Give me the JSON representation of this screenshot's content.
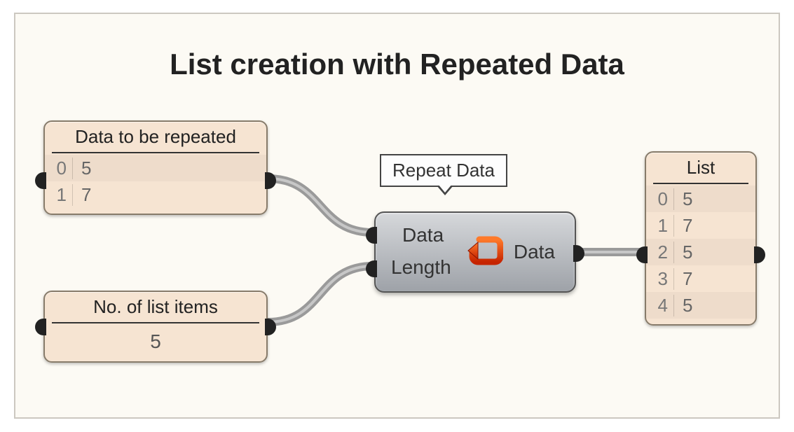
{
  "title": "List creation with Repeated Data",
  "panel_data": {
    "header": "Data to be repeated",
    "rows": [
      {
        "index": "0",
        "value": "5"
      },
      {
        "index": "1",
        "value": "7"
      }
    ]
  },
  "panel_count": {
    "header": "No. of list items",
    "value": "5"
  },
  "component": {
    "tooltip": "Repeat Data",
    "input_data": "Data",
    "input_length": "Length",
    "output_data": "Data"
  },
  "panel_result": {
    "header": "List",
    "rows": [
      {
        "index": "0",
        "value": "5"
      },
      {
        "index": "1",
        "value": "7"
      },
      {
        "index": "2",
        "value": "5"
      },
      {
        "index": "3",
        "value": "7"
      },
      {
        "index": "4",
        "value": "5"
      }
    ]
  }
}
